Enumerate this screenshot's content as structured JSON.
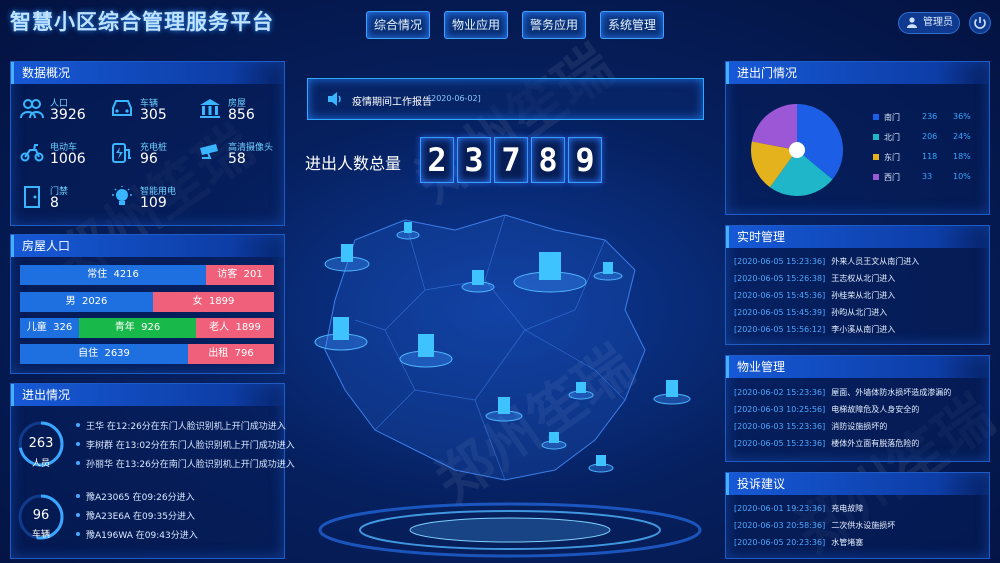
{
  "header": {
    "title": "智慧小区综合管理服务平台",
    "tabs": [
      "综合情况",
      "物业应用",
      "警务应用",
      "系统管理"
    ],
    "user_label": "管理员"
  },
  "overview": {
    "title": "数据概况",
    "items": [
      {
        "label": "人口",
        "value": "3926",
        "icon": "people-icon"
      },
      {
        "label": "车辆",
        "value": "305",
        "icon": "car-icon"
      },
      {
        "label": "房屋",
        "value": "856",
        "icon": "building-icon"
      },
      {
        "label": "电动车",
        "value": "1006",
        "icon": "scooter-icon"
      },
      {
        "label": "充电桩",
        "value": "96",
        "icon": "charger-icon"
      },
      {
        "label": "高清摄像头",
        "value": "58",
        "icon": "camera-icon"
      },
      {
        "label": "门禁",
        "value": "8",
        "icon": "door-icon"
      },
      {
        "label": "智能用电",
        "value": "109",
        "icon": "bulb-icon"
      }
    ]
  },
  "housing": {
    "title": "房屋人口",
    "rows": [
      [
        {
          "label": "常住",
          "value": "4216",
          "share": 0.72,
          "color": "#1e6fe0"
        },
        {
          "label": "访客",
          "value": "201",
          "share": 0.28,
          "color": "#f0607a"
        }
      ],
      [
        {
          "label": "男",
          "value": "2026",
          "share": 0.52,
          "color": "#1e6fe0"
        },
        {
          "label": "女",
          "value": "1899",
          "share": 0.48,
          "color": "#f0607a"
        }
      ],
      [
        {
          "label": "儿童",
          "value": "326",
          "share": 0.23,
          "color": "#1e6fe0"
        },
        {
          "label": "青年",
          "value": "926",
          "share": 0.46,
          "color": "#19b84a"
        },
        {
          "label": "老人",
          "value": "1899",
          "share": 0.31,
          "color": "#f0607a"
        }
      ],
      [
        {
          "label": "自住",
          "value": "2639",
          "share": 0.66,
          "color": "#1e6fe0"
        },
        {
          "label": "出租",
          "value": "796",
          "share": 0.34,
          "color": "#f0607a"
        }
      ]
    ]
  },
  "entry": {
    "title": "进出情况",
    "people": {
      "count": "263",
      "unit": "人员",
      "lines": [
        "王华 在12:26分在东门人脸识别机上开门成功进入",
        "李树群 在13:02分在东门人脸识别机上开门成功进入",
        "孙丽华 在13:26分在南门人脸识别机上开门成功进入"
      ]
    },
    "vehicles": {
      "count": "96",
      "unit": "车辆",
      "lines": [
        "豫A23065 在09:26分进入",
        "豫A23E6A 在09:35分进入",
        "豫A196WA 在09:43分进入"
      ]
    }
  },
  "center": {
    "notice_title": "疫情期间工作报告",
    "notice_date": "[2020-06-02]",
    "counter_label": "进出人数总量",
    "digits": [
      "2",
      "3",
      "7",
      "8",
      "9"
    ]
  },
  "gates": {
    "title": "进出门情况",
    "items": [
      {
        "name": "南门",
        "value": "236",
        "percent": "36%",
        "share": 0.36,
        "color": "#1c5fe6"
      },
      {
        "name": "北门",
        "value": "206",
        "percent": "24%",
        "share": 0.24,
        "color": "#1fb6c9"
      },
      {
        "name": "东门",
        "value": "118",
        "percent": "18%",
        "share": 0.18,
        "color": "#e3b21c"
      },
      {
        "name": "西门",
        "value": "33",
        "percent": "10%",
        "share": 0.22,
        "color": "#9b57d6"
      }
    ]
  },
  "realtime": {
    "title": "实时管理",
    "rows": [
      {
        "time": "[2020-06-05 15:23:36]",
        "text": "外来人员王文从南门进入"
      },
      {
        "time": "[2020-06-05 15:26:38]",
        "text": "王志权从北门进入"
      },
      {
        "time": "[2020-06-05 15:45:36]",
        "text": "孙桂荣从北门进入"
      },
      {
        "time": "[2020-06-05 15:45:39]",
        "text": "孙昀从北门进入"
      },
      {
        "time": "[2020-06-05 15:56:12]",
        "text": "李小溪从南门进入"
      }
    ]
  },
  "property": {
    "title": "物业管理",
    "rows": [
      {
        "time": "[2020-06-02 15:23:36]",
        "text": "屋面、外墙体防水损坏造成渗漏的"
      },
      {
        "time": "[2020-06-03 10:25:56]",
        "text": "电梯故障危及人身安全的"
      },
      {
        "time": "[2020-06-03 15:23:36]",
        "text": "消防设施损坏的"
      },
      {
        "time": "[2020-06-05 15:23:36]",
        "text": "楼体外立面有脱落危险的"
      }
    ]
  },
  "complaints": {
    "title": "投诉建议",
    "rows": [
      {
        "time": "[2020-06-01 19:23:36]",
        "text": "充电故障"
      },
      {
        "time": "[2020-06-03 20:58:36]",
        "text": "二次供水设施损坏"
      },
      {
        "time": "[2020-06-05 20:23:36]",
        "text": "水管堵塞"
      }
    ]
  },
  "watermark": "郑州笙瑞"
}
